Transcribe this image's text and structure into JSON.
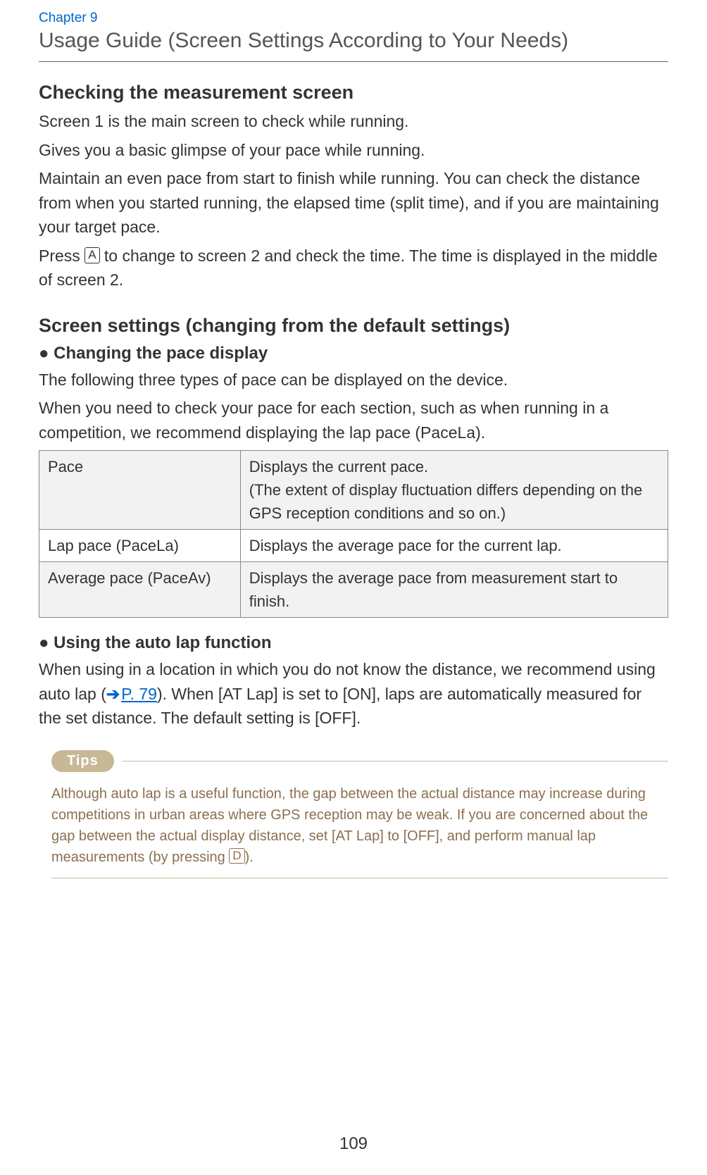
{
  "chapter_label": "Chapter 9",
  "page_title": "Usage Guide (Screen Settings According to Your Needs)",
  "section1": {
    "heading": "Checking the measurement screen",
    "p1": "Screen 1 is the main screen to check while running.",
    "p2": "Gives you a basic glimpse of your pace while running.",
    "p3": "Maintain an even pace from start to finish while running. You can check the distance from when you started running, the elapsed time (split time), and if you are maintaining your target pace.",
    "p4_pre": "Press ",
    "p4_key": "A",
    "p4_post": " to change to screen 2 and check the time. The time is displayed in the middle of screen 2."
  },
  "section2": {
    "heading": "Screen settings (changing from the default settings)",
    "sub1_heading": "● Changing the pace display",
    "sub1_p1": "The following three types of pace can be displayed on the device.",
    "sub1_p2": "When you need to check your pace for each section, such as when running in a competition, we recommend displaying the lap pace (PaceLa).",
    "table": {
      "r1c1": "Pace",
      "r1c2a": "Displays the current pace.",
      "r1c2b": "(The extent of display fluctuation differs depending on the GPS reception conditions and so on.)",
      "r2c1": "Lap pace (PaceLa)",
      "r2c2": "Displays the average pace for the current lap.",
      "r3c1": "Average pace (PaceAv)",
      "r3c2": "Displays the average pace from measurement start to finish."
    },
    "sub2_heading": "● Using the auto lap function",
    "sub2_p1_pre": "When using in a location in which you do not know the distance, we recommend using auto lap (",
    "sub2_link": "P. 79",
    "sub2_p1_post": "). When [AT Lap] is set to [ON], laps are automatically measured for the set distance. The default setting is [OFF]."
  },
  "tips": {
    "label": "Tips",
    "text_pre": "Although auto lap is a useful function, the gap between the actual distance may increase during competitions in urban areas where GPS reception may be weak. If you are concerned about the gap between the actual display distance, set [AT Lap] to [OFF], and perform manual lap measurements (by pressing ",
    "key": "D",
    "text_post": ")."
  },
  "page_number": "109"
}
